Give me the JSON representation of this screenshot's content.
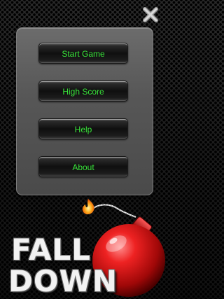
{
  "menu": {
    "items": [
      {
        "label": "Start Game"
      },
      {
        "label": "High Score"
      },
      {
        "label": "Help"
      },
      {
        "label": "About"
      }
    ]
  },
  "title": {
    "line1": "FALL",
    "line2": "DOWN"
  },
  "icons": {
    "close": "close-icon",
    "bomb": "bomb-icon",
    "fuse": "fuse-flame-icon"
  },
  "colors": {
    "menu_text": "#39e43a",
    "bomb_red": "#e01818",
    "panel": "#5c5c5c"
  }
}
